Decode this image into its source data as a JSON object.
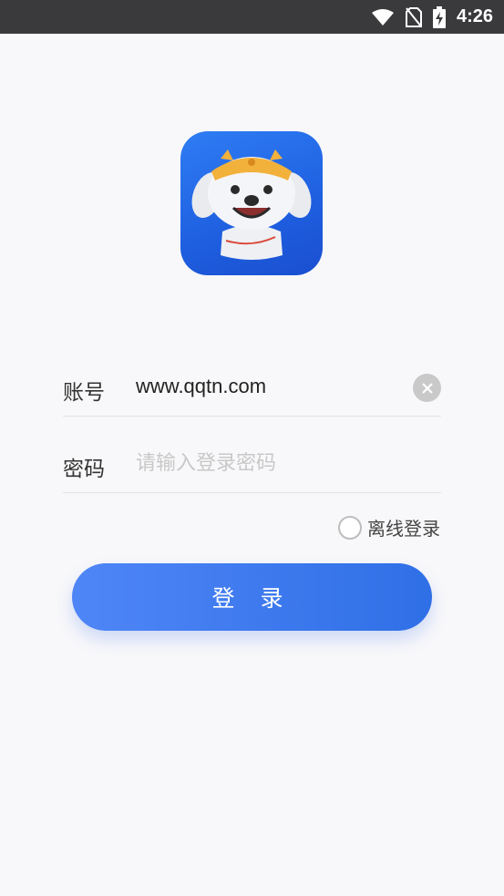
{
  "status_bar": {
    "time": "4:26",
    "icons": [
      "wifi-icon",
      "no-sim-icon",
      "battery-charging-icon"
    ]
  },
  "app": {
    "logo_icon": "jd-dog-mascot-logo"
  },
  "form": {
    "account": {
      "label": "账号",
      "value": "www.qqtn.com",
      "clear_icon": "clear-icon"
    },
    "password": {
      "label": "密码",
      "value": "",
      "placeholder": "请输入登录密码"
    },
    "offline_login": {
      "label": "离线登录",
      "checked": false
    },
    "login_button_label": "登 录"
  },
  "colors": {
    "accent_start": "#4f86f7",
    "accent_end": "#2f6fe6",
    "logo_blue": "#2f7df4",
    "status_bar": "#3a3a3c"
  }
}
